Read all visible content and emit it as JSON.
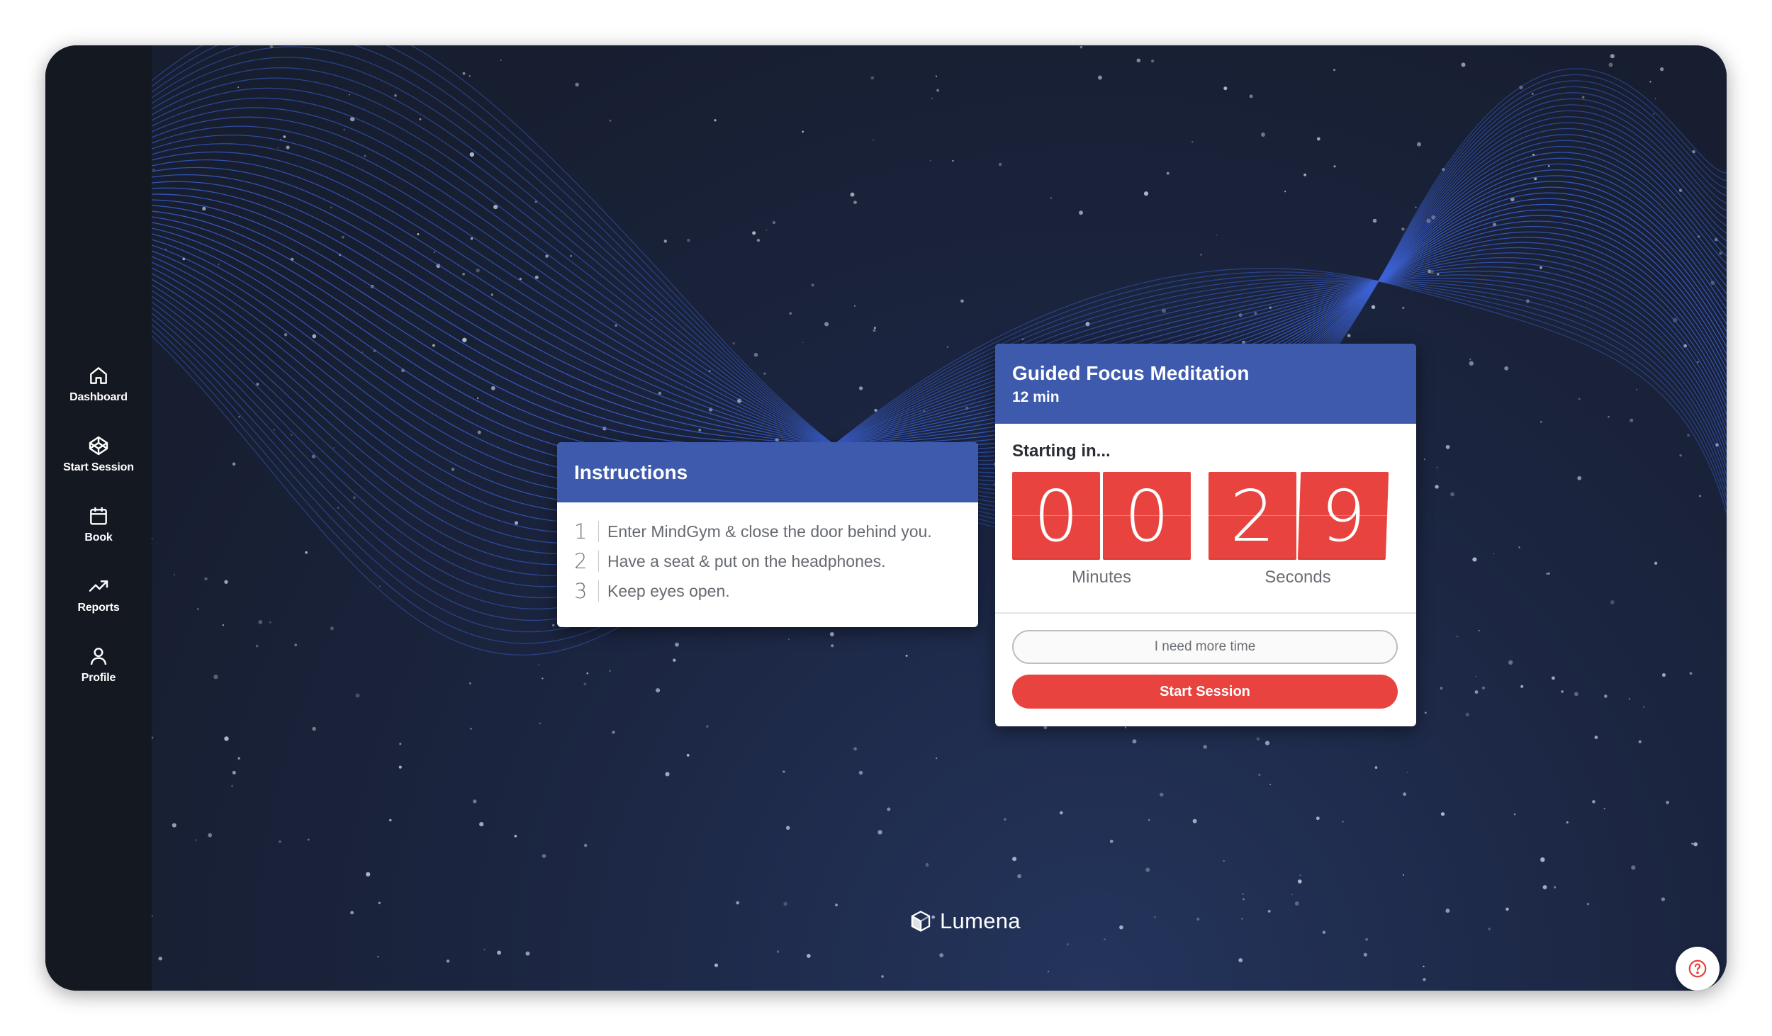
{
  "sidebar": {
    "items": [
      {
        "label": "Dashboard",
        "icon": "home-icon"
      },
      {
        "label": "Start Session",
        "icon": "session-icon"
      },
      {
        "label": "Book",
        "icon": "calendar-icon"
      },
      {
        "label": "Reports",
        "icon": "trend-up-icon"
      },
      {
        "label": "Profile",
        "icon": "user-icon"
      }
    ]
  },
  "instructions": {
    "title": "Instructions",
    "steps": [
      {
        "num": "1",
        "text": "Enter MindGym & close the door behind you."
      },
      {
        "num": "2",
        "text": "Have a seat & put on the headphones."
      },
      {
        "num": "3",
        "text": "Keep eyes open."
      }
    ]
  },
  "session": {
    "title": "Guided Focus Meditation",
    "duration": "12 min",
    "starting_label": "Starting in...",
    "countdown": {
      "minutes": [
        "0",
        "0"
      ],
      "seconds": [
        "2",
        "9"
      ],
      "minutes_label": "Minutes",
      "seconds_label": "Seconds"
    },
    "more_time_label": "I need more time",
    "start_label": "Start Session"
  },
  "brand": {
    "name": "Lumena"
  },
  "help": {
    "icon": "help-icon"
  },
  "colors": {
    "accent_blue": "#3e5aad",
    "accent_red": "#e8433e",
    "sidebar_bg": "#141821",
    "background": "#1b2540"
  }
}
